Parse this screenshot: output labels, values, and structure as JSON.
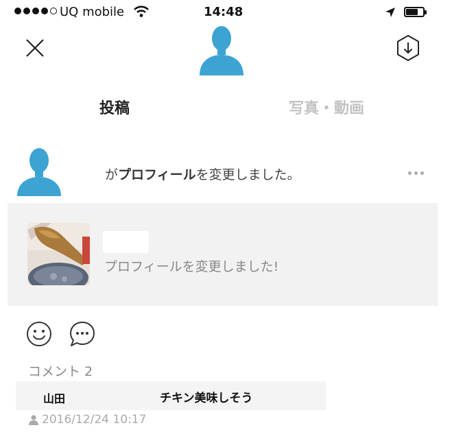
{
  "status_bar": {
    "carrier": "UQ mobile",
    "time": "14:48",
    "battery_percent": 70
  },
  "tabs": [
    {
      "label": "投稿",
      "active": true
    },
    {
      "label": "写真・動画",
      "active": false
    }
  ],
  "post": {
    "headline_prefix": "が",
    "headline_bold": "プロフィール",
    "headline_suffix": "を変更しました。",
    "card_text": "プロフィールを変更しました!"
  },
  "comments": {
    "count_label": "コメント 2",
    "items": [
      {
        "author": "山田",
        "text": "チキン美味しそう",
        "timestamp": "2016/12/24 10:17"
      }
    ]
  },
  "colors": {
    "avatar_blue": "#3ca3d3",
    "inactive_tab": "#c3c3c3",
    "card_bg": "#f2f2f2"
  },
  "icons": [
    "close-icon",
    "download-icon",
    "avatar-silhouette-icon",
    "more-icon",
    "smile-icon",
    "comment-bubble-icon",
    "person-icon",
    "wifi-icon",
    "location-arrow-icon",
    "battery-icon"
  ]
}
